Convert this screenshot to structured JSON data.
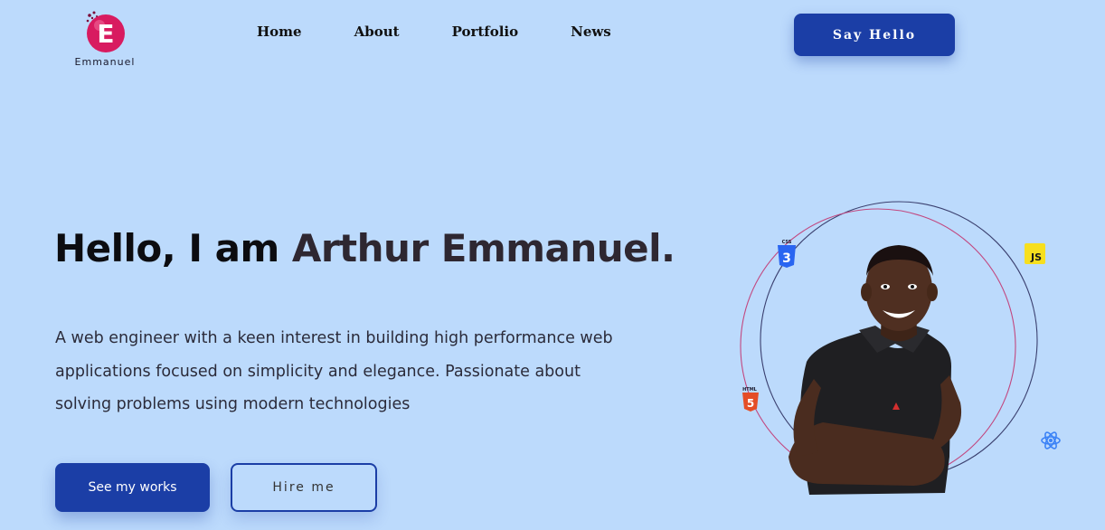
{
  "brand": {
    "logo_icon": "e-letter-logo-icon",
    "logo_letter": "E",
    "caption": "Emmanuel",
    "colors": {
      "logo_pink": "#d81b60",
      "logo_dark": "#7a0c3a"
    }
  },
  "nav": {
    "items": [
      {
        "label": "Home"
      },
      {
        "label": "About"
      },
      {
        "label": "Portfolio"
      },
      {
        "label": "News"
      }
    ]
  },
  "header": {
    "cta_label": "Say Hello"
  },
  "hero": {
    "greeting": "Hello, I am ",
    "name": "Arthur Emmanuel.",
    "bio": "A web engineer with a keen interest in building high performance web applications focused on simplicity and elegance. Passionate about solving problems using modern technologies",
    "primary_button": "See my works",
    "secondary_button": "Hire me",
    "photo_icon": "person-portrait-icon",
    "tech_icons": [
      {
        "name": "css3-icon",
        "badge_text": "CSS",
        "glyph": "3",
        "color": "#2965f1"
      },
      {
        "name": "javascript-icon",
        "badge_text": "JS",
        "color": "#f7df1e"
      },
      {
        "name": "html5-icon",
        "badge_text": "HTML",
        "glyph": "5",
        "color": "#e44d26"
      },
      {
        "name": "react-icon",
        "color": "#3b82f6"
      }
    ]
  },
  "colors": {
    "background": "#bcdafc",
    "accent": "#1b3ea6",
    "ring_dark": "#3a3f6e",
    "ring_pink": "#c2477f"
  }
}
